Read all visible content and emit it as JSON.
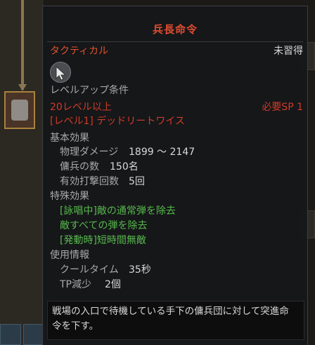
{
  "tooltip": {
    "title": "兵長命令",
    "skill_type": "タクティカル",
    "learned_status": "未習得",
    "levelup_heading": "レベルアップ条件",
    "req_level": "20レベル以上",
    "req_skill": "[レベル1] デッドリートワイス",
    "req_sp": "必要SP 1",
    "basic_heading": "基本効果",
    "stats": [
      {
        "label": "物理ダメージ",
        "value": "1899 ～ 2147"
      },
      {
        "label": "傭兵の数",
        "value": "150名"
      },
      {
        "label": "有効打撃回数",
        "value": "5回"
      }
    ],
    "special_heading": "特殊効果",
    "special_effects": [
      "[詠唱中]敵の通常弾を除去",
      "敵すべての弾を除去",
      "[発動時]短時間無敵"
    ],
    "usage_heading": "使用情報",
    "usage": [
      {
        "label": "クールタイム",
        "value": "35秒"
      },
      {
        "label": "TP減少",
        "value": "2個"
      }
    ],
    "description": "戦場の入口で待機している手下の傭兵団に対して突進命令を下す。"
  },
  "icons": {
    "skill_type_icon": "cursor-arrow-icon",
    "background_skill_icon": "helmet-skill-icon"
  },
  "colors": {
    "title": "#e04d30",
    "requirement": "#cf3b28",
    "special": "#56b94c",
    "text": "#d8d8d8"
  }
}
